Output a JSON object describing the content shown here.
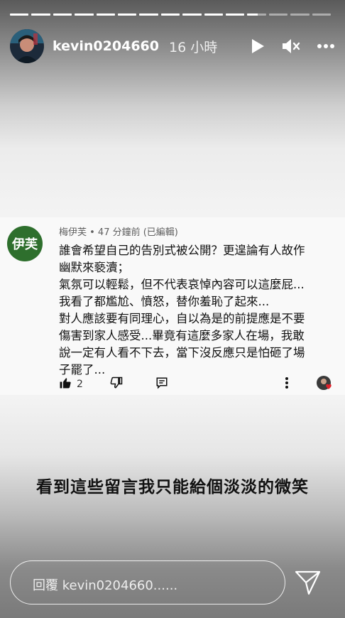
{
  "progress": {
    "total_segments": 15,
    "current_segment": 12,
    "current_fill": 0.55
  },
  "header": {
    "username": "kevin0204660",
    "time": "16 小時"
  },
  "comment": {
    "avatar_text": "伊芙",
    "meta": "梅伊芙 • 47 分鐘前 (已編輯)",
    "body": "誰會希望自己的告別式被公開？更遑論有人故作\n幽默來褻瀆；\n氣氛可以輕鬆，但不代表哀悼內容可以這麼屁...\n我看了都尷尬、憤怒，替你羞恥了起來...\n對人應該要有同理心，自以為是的前提應是不要\n傷害到家人感受...畢竟有這麼多家人在場，我敢\n說一定有人看不下去，當下沒反應只是怕砸了場\n子罷了...",
    "likes": "2"
  },
  "caption": "看到這些留言我只能給個淡淡的微笑",
  "reply": {
    "placeholder": "回覆 kevin0204660......"
  }
}
